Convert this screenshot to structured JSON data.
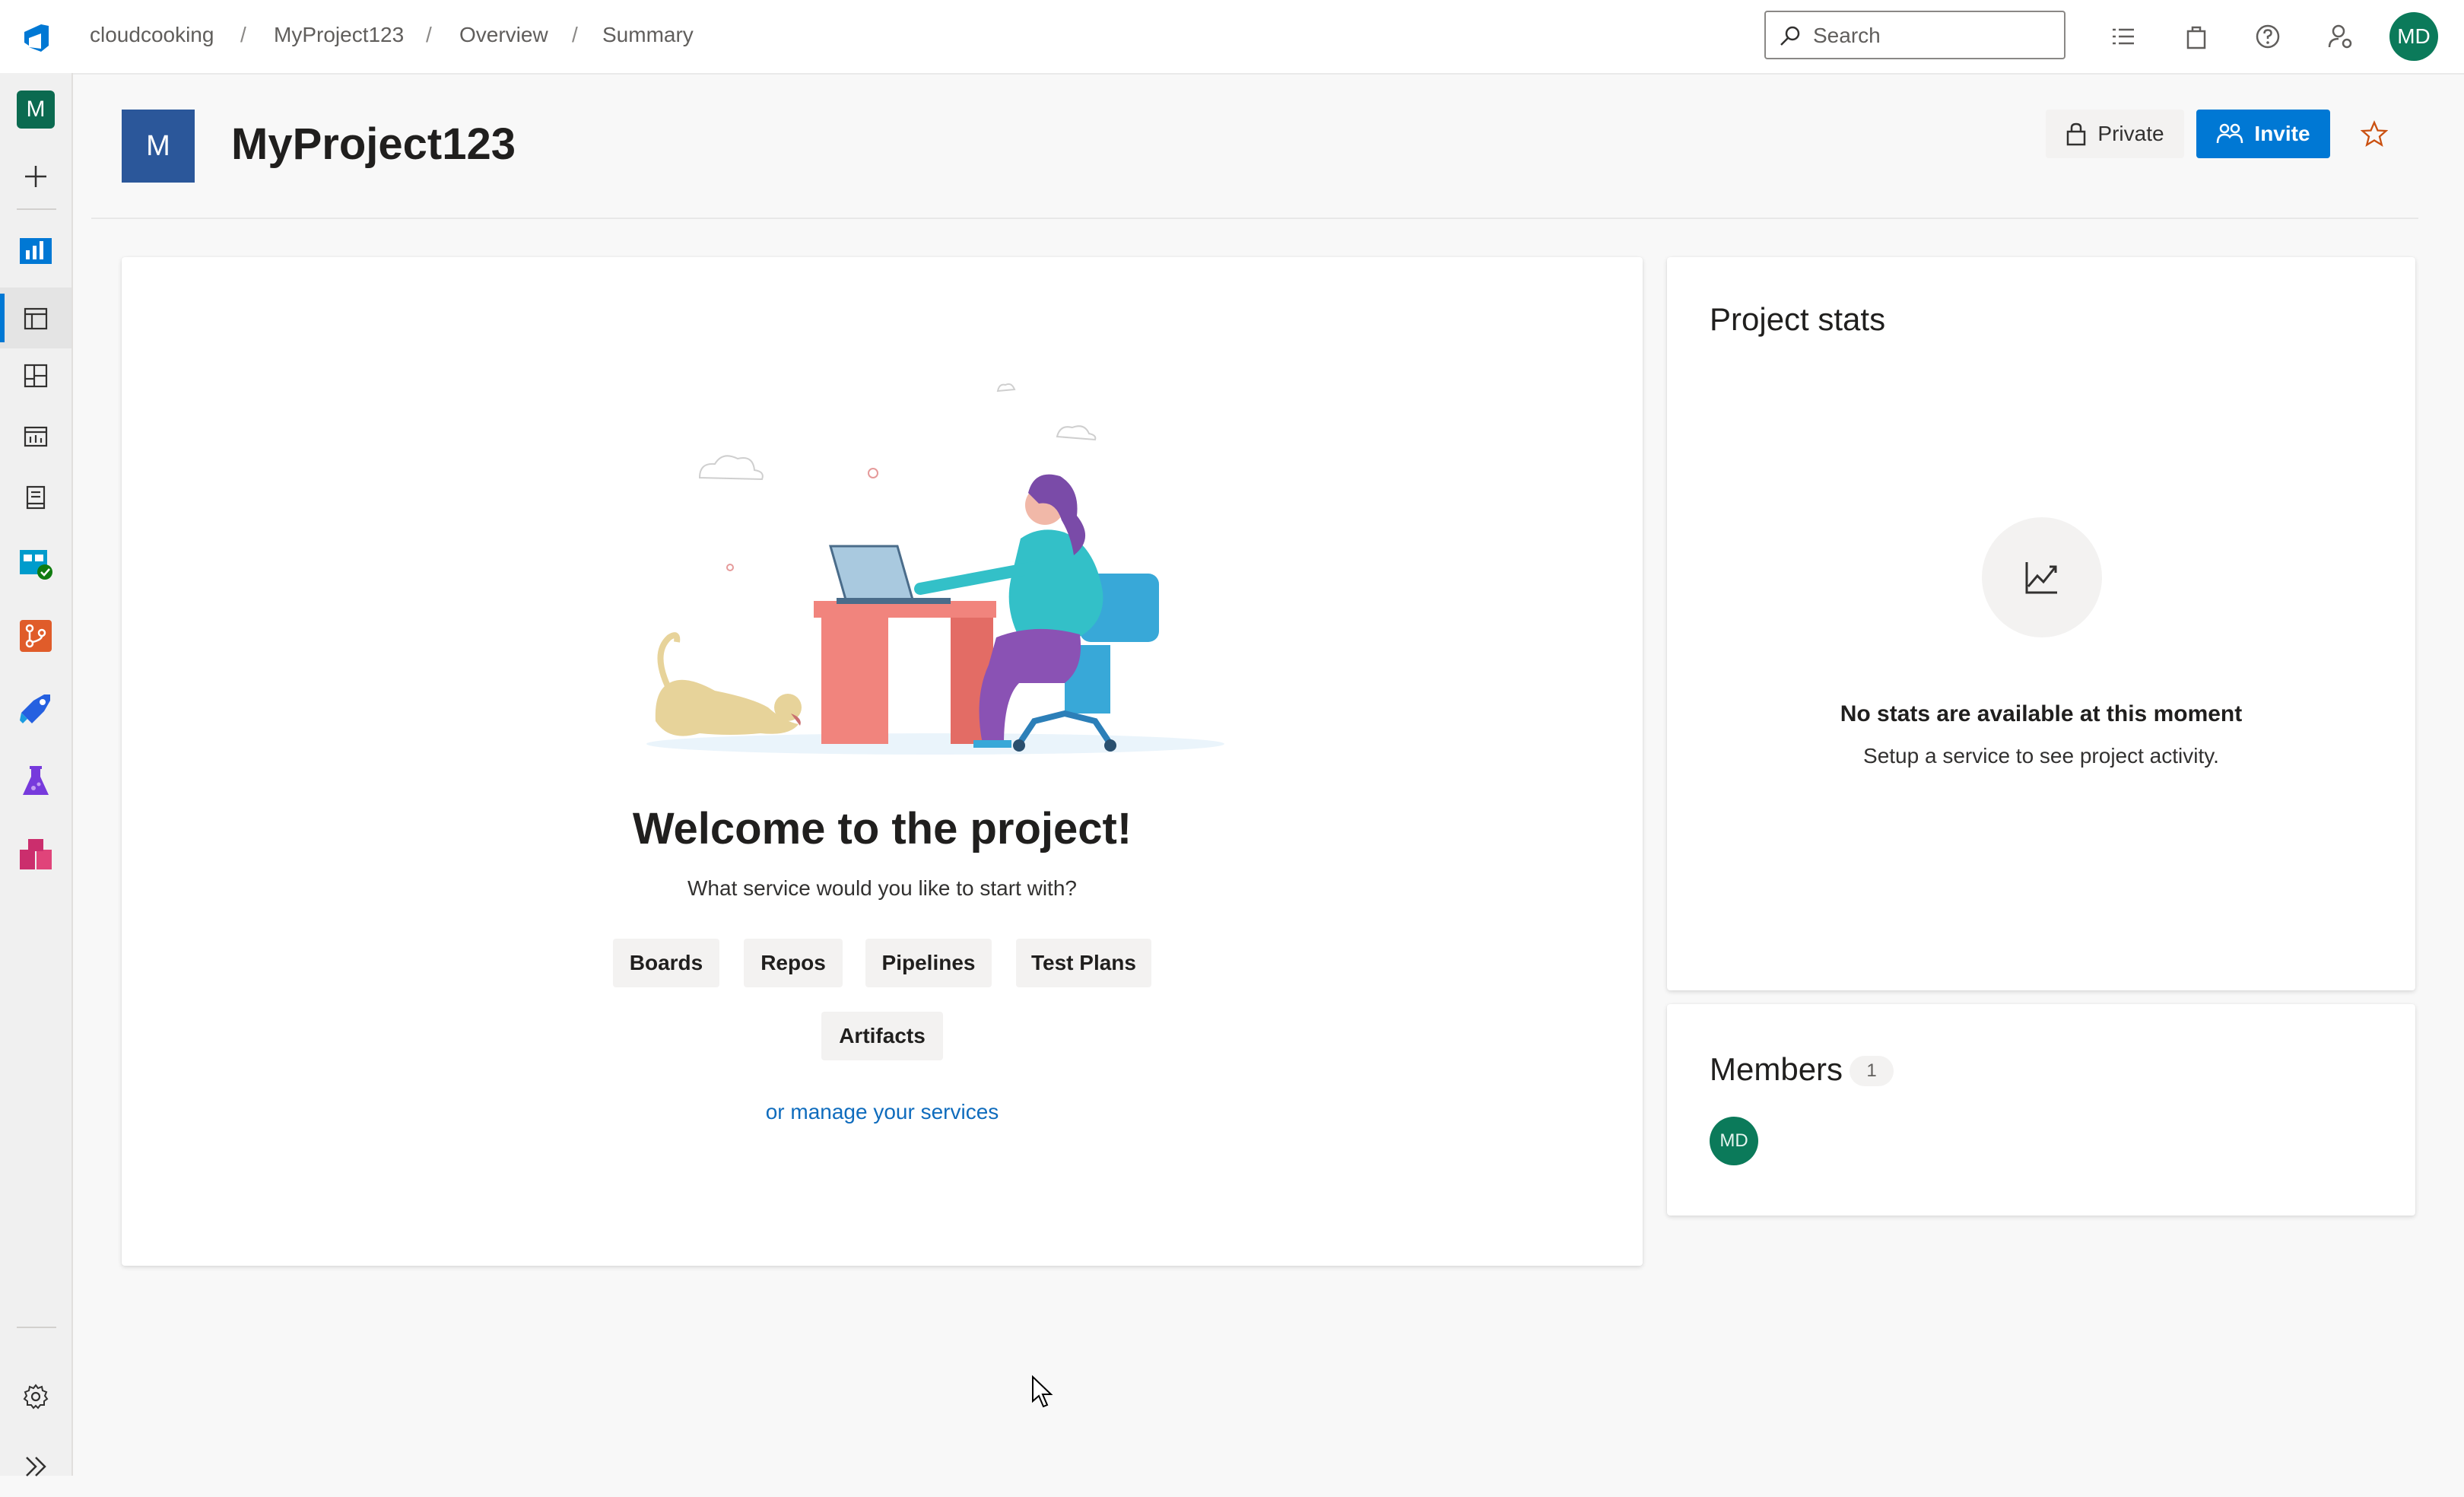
{
  "breadcrumb": {
    "org": "cloudcooking",
    "project": "MyProject123",
    "section": "Overview",
    "page": "Summary",
    "separator": "/"
  },
  "search": {
    "placeholder": "Search"
  },
  "user": {
    "initials": "MD"
  },
  "rail": {
    "project_initial": "M",
    "items": [
      {
        "name": "add-icon"
      },
      {
        "name": "overview-icon"
      },
      {
        "name": "summary-icon"
      },
      {
        "name": "dashboards-icon"
      },
      {
        "name": "analytics-icon"
      },
      {
        "name": "wiki-icon"
      },
      {
        "name": "boards-icon"
      },
      {
        "name": "repos-icon"
      },
      {
        "name": "pipelines-icon"
      },
      {
        "name": "test-plans-icon"
      },
      {
        "name": "artifacts-icon"
      },
      {
        "name": "settings-icon"
      },
      {
        "name": "expand-icon"
      }
    ]
  },
  "project": {
    "initial": "M",
    "name": "MyProject123",
    "visibility": "Private",
    "invite_label": "Invite"
  },
  "welcome": {
    "title": "Welcome to the project!",
    "subtitle": "What service would you like to start with?",
    "services": [
      "Boards",
      "Repos",
      "Pipelines",
      "Test Plans",
      "Artifacts"
    ],
    "manage_link": "or manage your services"
  },
  "stats": {
    "title": "Project stats",
    "empty_title": "No stats are available at this moment",
    "empty_subtitle": "Setup a service to see project activity."
  },
  "members": {
    "title": "Members",
    "count": "1",
    "list": [
      {
        "initials": "MD"
      }
    ]
  },
  "colors": {
    "accent": "#0078d4",
    "project_avatar": "#2b579a",
    "user_avatar": "#0b7a5a"
  }
}
